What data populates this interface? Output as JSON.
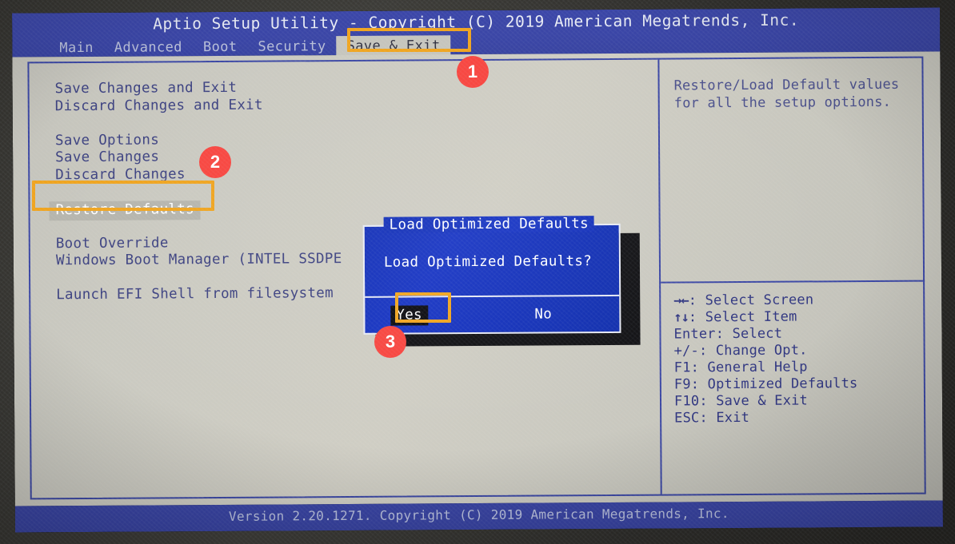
{
  "window": {
    "title": "Aptio Setup Utility - Copyright (C) 2019 American Megatrends, Inc.",
    "footer": "Version 2.20.1271. Copyright (C) 2019 American Megatrends, Inc."
  },
  "menubar": {
    "tabs": [
      {
        "label": "Main",
        "active": false
      },
      {
        "label": "Advanced",
        "active": false
      },
      {
        "label": "Boot",
        "active": false
      },
      {
        "label": "Security",
        "active": false
      },
      {
        "label": "Save & Exit",
        "active": true
      }
    ]
  },
  "options": [
    {
      "label": "Save Changes and Exit",
      "selected": false
    },
    {
      "label": "Discard Changes and Exit",
      "selected": false
    },
    {
      "label": "",
      "selected": false
    },
    {
      "label": "Save Options",
      "selected": false
    },
    {
      "label": "Save Changes",
      "selected": false
    },
    {
      "label": "Discard Changes",
      "selected": false
    },
    {
      "label": "",
      "selected": false
    },
    {
      "label": "Restore Defaults",
      "selected": true
    },
    {
      "label": "",
      "selected": false
    },
    {
      "label": "Boot Override",
      "selected": false
    },
    {
      "label": "Windows Boot Manager (INTEL SSDPE",
      "selected": false
    },
    {
      "label": "",
      "selected": false
    },
    {
      "label": "Launch EFI Shell from filesystem",
      "selected": false
    }
  ],
  "help": {
    "lines": [
      "Restore/Load Default values",
      "for all the setup options."
    ]
  },
  "keys": [
    {
      "glyph": "→←",
      "text": ": Select Screen"
    },
    {
      "glyph": "↑↓",
      "text": ": Select Item"
    },
    {
      "glyph": "",
      "text": "Enter: Select"
    },
    {
      "glyph": "",
      "text": "+/-: Change Opt."
    },
    {
      "glyph": "",
      "text": "F1: General Help"
    },
    {
      "glyph": "",
      "text": "F9: Optimized Defaults"
    },
    {
      "glyph": "",
      "text": "F10: Save & Exit"
    },
    {
      "glyph": "",
      "text": "ESC: Exit"
    }
  ],
  "dialog": {
    "title": "Load Optimized Defaults",
    "message": "Load Optimized Defaults?",
    "yes_label": "Yes",
    "no_label": "No",
    "selected_button": "Yes"
  },
  "annotations": {
    "accent_color": "#f0a41e",
    "badge_color": "#f8453f",
    "steps": [
      {
        "number": "1",
        "target": "Save & Exit tab"
      },
      {
        "number": "2",
        "target": "Restore Defaults option"
      },
      {
        "number": "3",
        "target": "Yes button"
      }
    ]
  }
}
